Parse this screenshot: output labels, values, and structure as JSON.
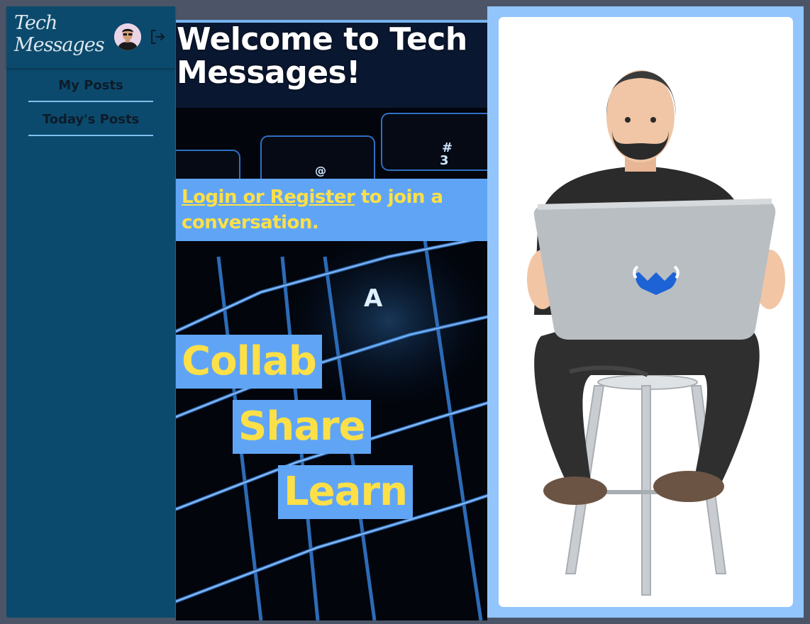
{
  "brand": {
    "logo_line1": "Tech",
    "logo_line2": "Messages"
  },
  "nav": {
    "items": [
      {
        "label": "My Posts"
      },
      {
        "label": "Today's Posts"
      }
    ]
  },
  "hero": {
    "title_line1": "Welcome to Tech",
    "title_line2": "Messages!",
    "join_link": "Login or Register",
    "join_text": " to join a conversation."
  },
  "tags": [
    "Collab",
    "Share",
    "Learn"
  ],
  "icons": {
    "avatar": "user-avatar",
    "logout": "logout-icon",
    "illustration": "developer-with-laptop"
  },
  "colors": {
    "sidebar": "#0b4a6c",
    "accent_blue": "#60a5f5",
    "accent_yellow": "#fde047",
    "panel": "#93c5fd"
  }
}
